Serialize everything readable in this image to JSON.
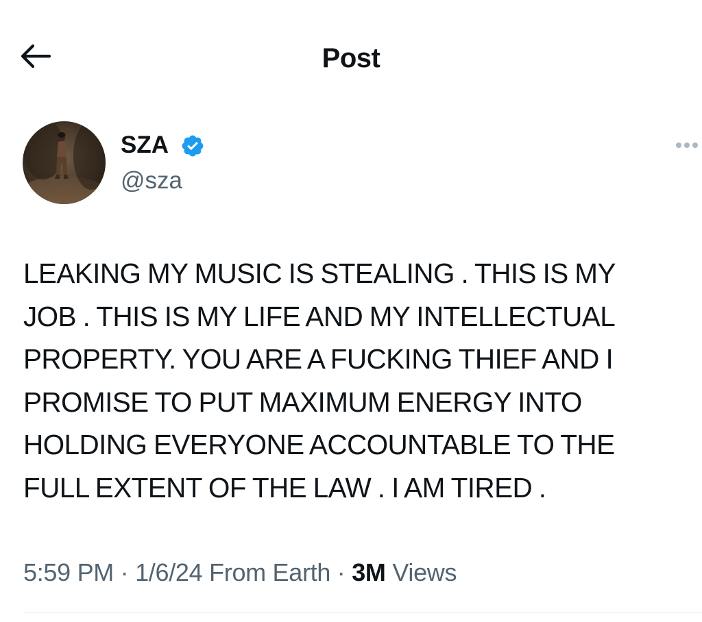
{
  "header": {
    "title": "Post",
    "back_icon": "arrow-left-icon"
  },
  "author": {
    "display_name": "SZA",
    "handle": "@sza",
    "verified_icon": "verified-badge-icon",
    "verified_color": "#1d9bf0"
  },
  "menu": {
    "icon": "more-horizontal-icon"
  },
  "post": {
    "text": "LEAKING MY MUSIC IS STEALING . THIS IS MY\nJOB . THIS IS MY LIFE AND MY INTELLECTUAL\nPROPERTY. YOU ARE A FUCKING THIEF AND I\nPROMISE TO PUT MAXIMUM ENERGY INTO\nHOLDING EVERYONE ACCOUNTABLE TO THE\nFULL EXTENT OF THE LAW . I AM TIRED ."
  },
  "meta": {
    "time": "5:59 PM",
    "separator": " · ",
    "date": "1/6/24",
    "source": " From Earth",
    "views_count": "3M",
    "views_label": "Views"
  },
  "colors": {
    "text": "#0f1419",
    "secondary": "#536471",
    "divider": "#e1e6ea"
  }
}
